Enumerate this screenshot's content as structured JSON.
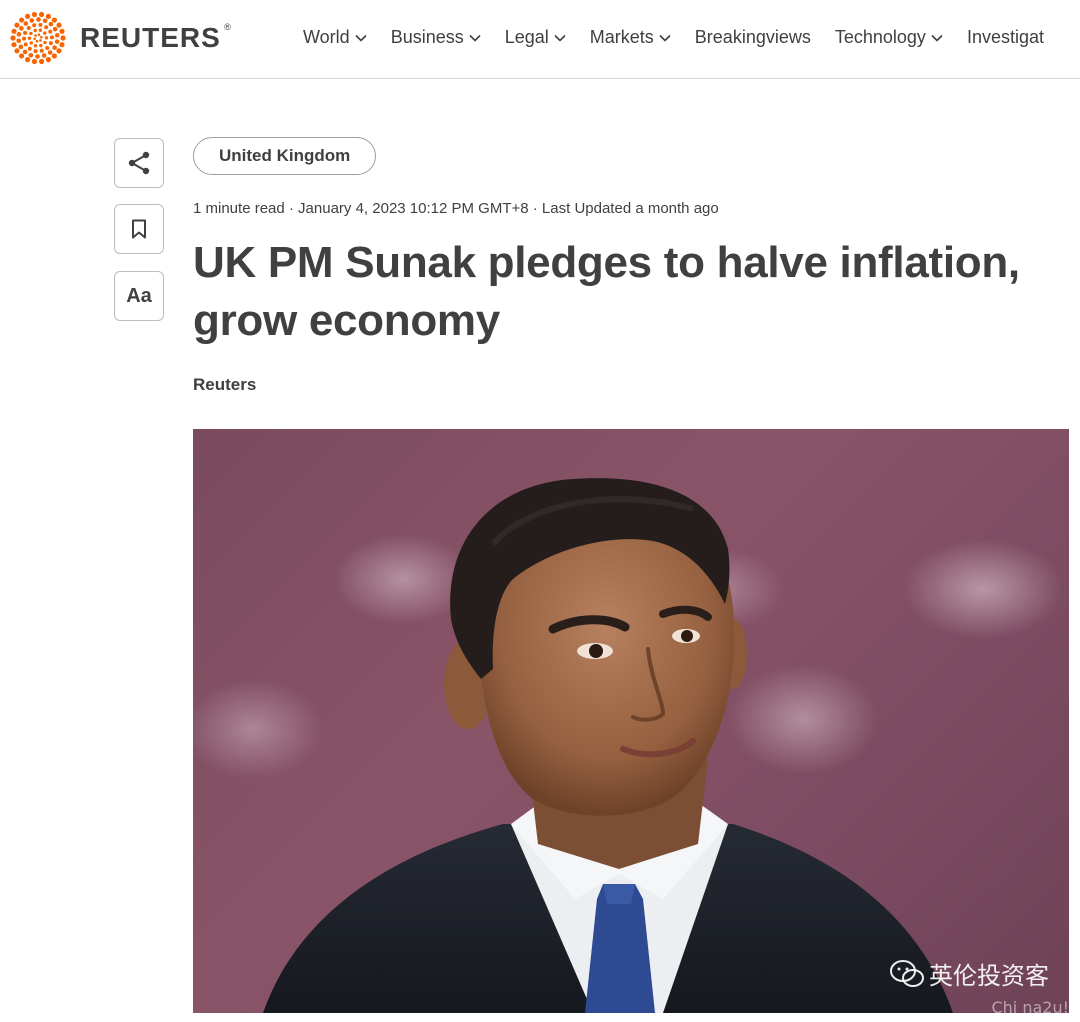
{
  "site": {
    "name": "REUTERS",
    "registered": "®"
  },
  "nav": {
    "items": [
      {
        "label": "World",
        "has_dropdown": true
      },
      {
        "label": "Business",
        "has_dropdown": true
      },
      {
        "label": "Legal",
        "has_dropdown": true
      },
      {
        "label": "Markets",
        "has_dropdown": true
      },
      {
        "label": "Breakingviews",
        "has_dropdown": false
      },
      {
        "label": "Technology",
        "has_dropdown": true
      },
      {
        "label": "Investigat",
        "has_dropdown": false
      }
    ]
  },
  "actions": {
    "share_icon": "share-icon",
    "bookmark_icon": "bookmark-icon",
    "text_size_label": "Aa"
  },
  "article": {
    "category": "United Kingdom",
    "meta": "1 minute read · January 4, 2023 10:12 PM GMT+8 · Last Updated a month ago",
    "headline": "UK PM Sunak pledges to halve inflation, grow economy",
    "byline": "Reuters"
  },
  "watermark": {
    "text": "英伦投资客",
    "sub": "Chi na2u!"
  },
  "colors": {
    "brand_orange": "#fa6400",
    "text": "#404040",
    "photo_background": "#7d4c62"
  }
}
